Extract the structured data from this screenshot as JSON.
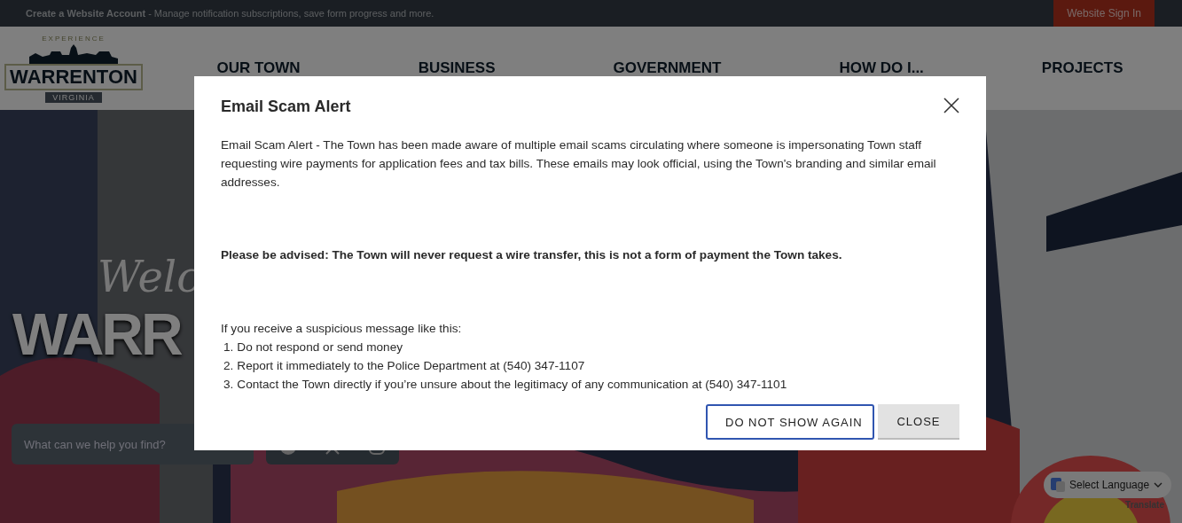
{
  "top_bar": {
    "account_link": "Create a Website Account",
    "account_text": " - Manage notification subscriptions, save form progress and more.",
    "sign_in": "Website Sign In"
  },
  "logo": {
    "top": "EXPERIENCE",
    "name": "WARRENTON",
    "state": "VIRGINIA"
  },
  "nav": [
    "OUR TOWN",
    "BUSINESS",
    "GOVERNMENT",
    "HOW DO I...",
    "PROJECTS"
  ],
  "hero": {
    "kind": "picture",
    "script_word": "Welc",
    "headline": "WARR"
  },
  "search": {
    "placeholder": "What can we help you find?"
  },
  "translate": {
    "select": "Select Language",
    "brand": "Translate"
  },
  "modal": {
    "title": "Email Scam Alert",
    "intro": "Email Scam Alert - The Town has been made aware of multiple email scams circulating where someone is impersonating Town staff requesting wire payments for application fees and tax bills. These emails may look official, using the Town's branding and similar email addresses.",
    "advisory": "Please be advised: The Town will never request a wire transfer, this is not a form of payment the Town takes.",
    "list_intro": "If you receive a suspicious message like this:",
    "steps": [
      {
        "number": "1.",
        "text": "Do not respond or send money"
      },
      {
        "number": "2.",
        "text": "Report it immediately to the Police Department at (540) 347-1107"
      },
      {
        "number": "3.",
        "text": "Contact the Town directly if you’re unsure about the legitimacy of any communication at (540) 347-1101"
      }
    ],
    "buttons": [
      {
        "label": "DO NOT SHOW AGAIN",
        "kind": "outlined"
      },
      {
        "label": "CLOSE",
        "kind": "filled"
      }
    ]
  }
}
